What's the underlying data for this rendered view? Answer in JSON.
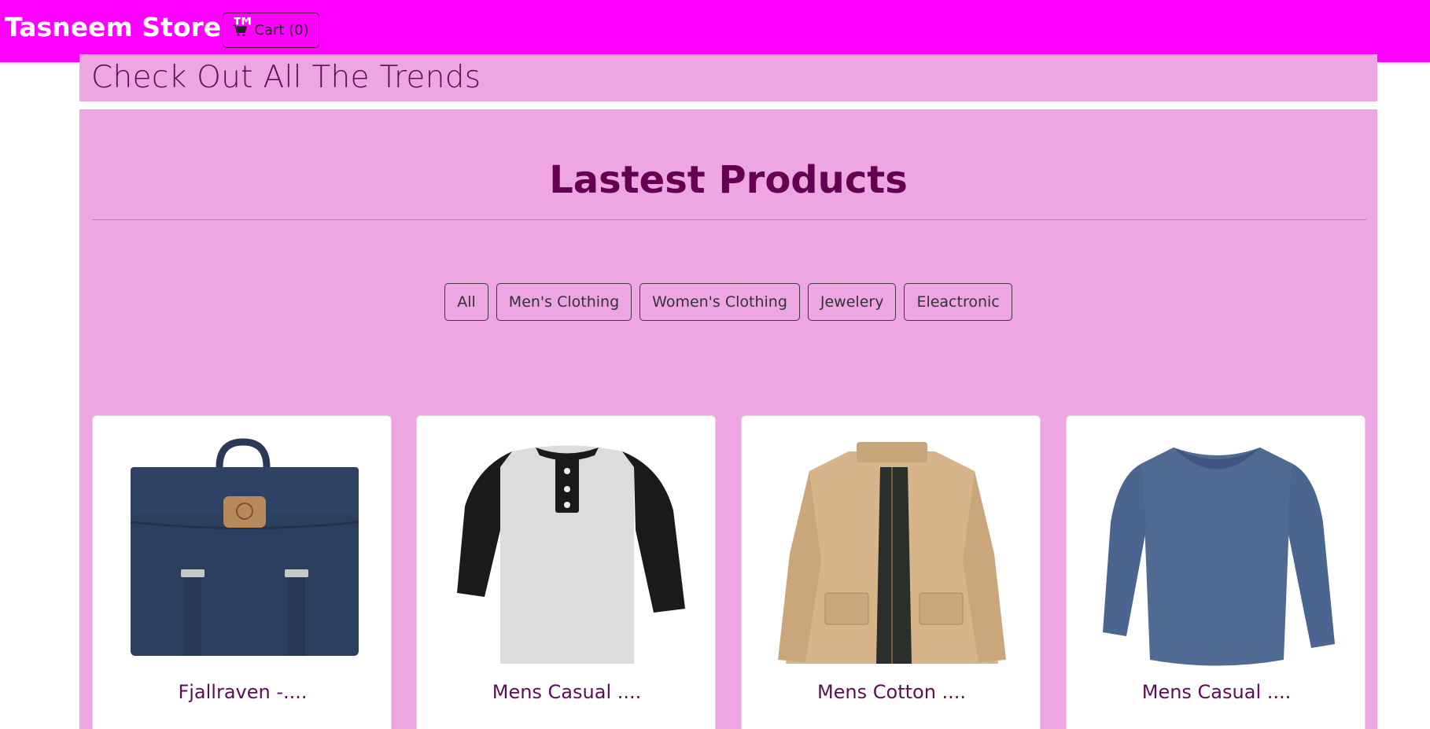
{
  "navbar": {
    "brand": "Tasneem Store ™",
    "cart_label": "Cart (0)",
    "cart_icon": "shopping-cart-icon",
    "background": "#ff00ff"
  },
  "banner": {
    "text": "Check Out All The Trends"
  },
  "main": {
    "heading": "Lastest Products",
    "filters": [
      "All",
      "Men's Clothing",
      "Women's Clothing",
      "Jewelery",
      "Eleactronic"
    ],
    "products": [
      {
        "title": "Fjallraven -....",
        "image": "navy-backpack"
      },
      {
        "title": "Mens Casual ....",
        "image": "raglan-henley-tshirt"
      },
      {
        "title": "Mens Cotton ....",
        "image": "khaki-cotton-jacket"
      },
      {
        "title": "Mens Casual ....",
        "image": "blue-long-sleeve-shirt"
      }
    ]
  },
  "colors": {
    "panel": "#eda6e2",
    "heading": "#63004f",
    "text": "#5c0e55"
  }
}
